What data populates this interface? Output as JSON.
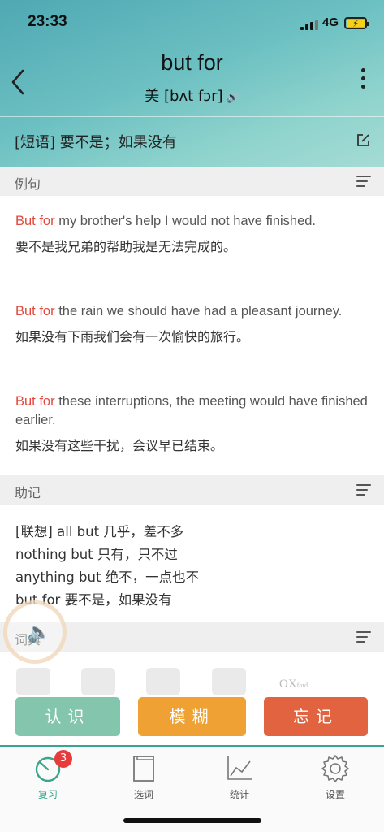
{
  "status_bar": {
    "time": "23:33",
    "network": "4G"
  },
  "word": {
    "text": "but for",
    "phonetic": "美 [bʌt fɔr]"
  },
  "meaning": "[短语] 要不是；如果没有",
  "sections": {
    "examples": "例句",
    "mnemonic": "助记",
    "dictionary": "词典"
  },
  "examples": [
    {
      "highlight": "But for",
      "rest": " my brother's help I would not have finished.",
      "zh": "要不是我兄弟的帮助我是无法完成的。"
    },
    {
      "highlight": "But for",
      "rest": " the rain we should have had a pleasant journey.",
      "zh": "如果没有下雨我们会有一次愉快的旅行。"
    },
    {
      "highlight": "But for",
      "rest": " these interruptions, the meeting would have finished earlier.",
      "zh": "如果没有这些干扰，会议早已结束。"
    }
  ],
  "mnemonic_lines": [
    "[联想] all but 几乎，差不多",
    "nothing but 只有，只不过",
    "anything but 绝不，一点也不",
    "but for 要不是，如果没有"
  ],
  "dict_icons": [
    "collins-icon",
    "search-dict-icon",
    "dict-app-icon",
    "bing-icon",
    "oxford-icon"
  ],
  "oxford_label": "OX",
  "oxford_small": "ford",
  "actions": {
    "know": "认识",
    "fuzzy": "模糊",
    "forget": "忘记"
  },
  "tabs": [
    {
      "label": "复习",
      "badge": "3"
    },
    {
      "label": "选词"
    },
    {
      "label": "统计"
    },
    {
      "label": "设置"
    }
  ],
  "colors": {
    "highlight": "#e2483d",
    "know": "#84c6ad",
    "fuzzy": "#efa133",
    "forget": "#e2633f",
    "accent": "#3aa58c"
  }
}
